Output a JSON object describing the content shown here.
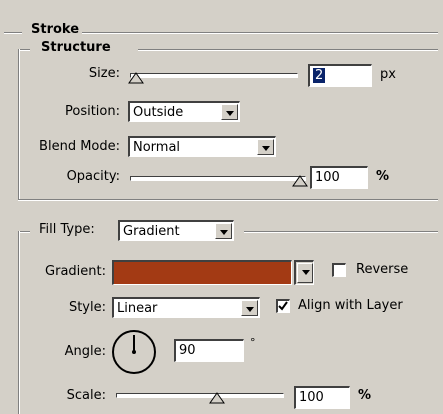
{
  "section_title": "Stroke",
  "structure": {
    "title": "Structure",
    "size": {
      "label": "Size:",
      "value": "2",
      "unit": "px",
      "slider_fraction": 0.02
    },
    "position": {
      "label": "Position:",
      "value": "Outside"
    },
    "blend_mode": {
      "label": "Blend Mode:",
      "value": "Normal"
    },
    "opacity": {
      "label": "Opacity:",
      "value": "100",
      "unit": "%",
      "slider_fraction": 1.0
    }
  },
  "fill": {
    "fill_type": {
      "label": "Fill Type:",
      "value": "Gradient"
    },
    "gradient": {
      "label": "Gradient:",
      "color": "#a33a14",
      "reverse_label": "Reverse",
      "reverse_checked": false
    },
    "style": {
      "label": "Style:",
      "value": "Linear",
      "align_label": "Align with Layer",
      "align_checked": true
    },
    "angle": {
      "label": "Angle:",
      "value": "90",
      "unit": "°",
      "degrees": 90
    },
    "scale": {
      "label": "Scale:",
      "value": "100",
      "unit": "%",
      "slider_fraction": 0.66
    }
  },
  "icons": {
    "slider_thumb": "triangle-thumb-icon",
    "dropdown_arrow": "chevron-down-icon",
    "checkmark": "checkmark-icon",
    "angle_dial": "angle-dial-icon"
  },
  "colors": {
    "panel_bg": "#d4d0c8",
    "gradient_swatch": "#a33a14"
  }
}
